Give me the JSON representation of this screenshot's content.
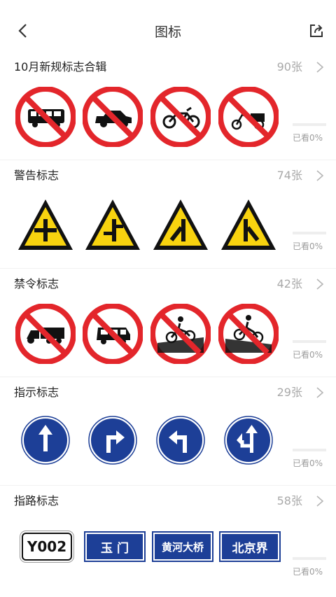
{
  "header": {
    "title": "图标"
  },
  "colors": {
    "prohibit_red": "#e3262b",
    "warn_yellow": "#f8d30f",
    "guide_blue": "#1d3f97",
    "progress": "#3b7cf6"
  },
  "sections": [
    {
      "title": "10月新规标志合辑",
      "count": "90张",
      "progress_label": "已看0%",
      "progress": 0,
      "signs": [
        "no-bus-sign",
        "no-car-sign",
        "no-motorcycle-sign",
        "no-tricycle-sign"
      ]
    },
    {
      "title": "警告标志",
      "count": "74张",
      "progress_label": "已看0%",
      "progress": 0,
      "signs": [
        "crossroad-warning-sign",
        "staggered-junction-warning-sign",
        "merge-left-warning-sign",
        "merge-right-warning-sign"
      ]
    },
    {
      "title": "禁令标志",
      "count": "42张",
      "progress_label": "已看0%",
      "progress": 0,
      "signs": [
        "no-tractor-sign",
        "no-minibus-sign",
        "no-cycling-down-slope-sign",
        "no-cycling-up-slope-sign"
      ]
    },
    {
      "title": "指示标志",
      "count": "29张",
      "progress_label": "已看0%",
      "progress": 0,
      "signs": [
        "straight-ahead-sign",
        "turn-right-sign",
        "turn-left-sign",
        "straight-or-left-sign"
      ]
    },
    {
      "title": "指路标志",
      "count": "58张",
      "progress_label": "已看0%",
      "progress": 0,
      "signs": [
        "road-number-sign",
        "place-name-sign",
        "bridge-name-sign",
        "boundary-sign"
      ],
      "route_texts": [
        "Y002",
        "玉 门",
        "黄河大桥",
        "北京界"
      ]
    }
  ]
}
